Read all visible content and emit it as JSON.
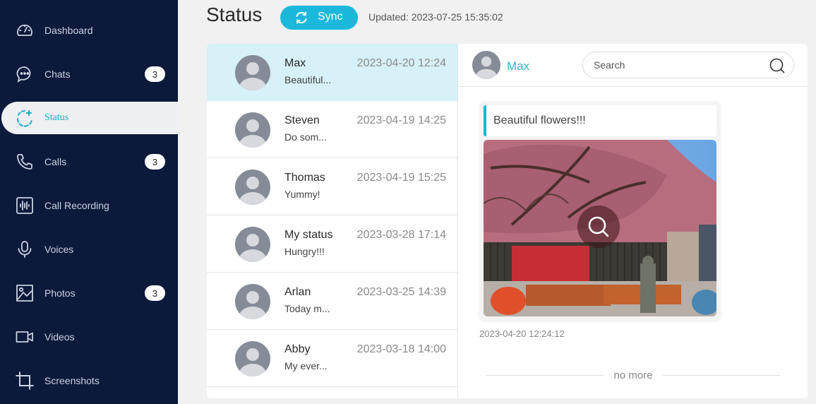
{
  "sidebar": {
    "items": [
      {
        "label": "Dashboard",
        "icon": "dashboard-icon",
        "badge": null,
        "active": false
      },
      {
        "label": "Chats",
        "icon": "chat-icon",
        "badge": "3",
        "active": false
      },
      {
        "label": "Status",
        "icon": "status-add-icon",
        "badge": null,
        "active": true
      },
      {
        "label": "Calls",
        "icon": "phone-icon",
        "badge": "3",
        "active": false
      },
      {
        "label": "Call Recording",
        "icon": "waveform-icon",
        "badge": null,
        "active": false
      },
      {
        "label": "Voices",
        "icon": "microphone-icon",
        "badge": null,
        "active": false
      },
      {
        "label": "Photos",
        "icon": "image-icon",
        "badge": "3",
        "active": false
      },
      {
        "label": "Videos",
        "icon": "video-camera-icon",
        "badge": null,
        "active": false
      },
      {
        "label": "Screenshots",
        "icon": "crop-icon",
        "badge": null,
        "active": false
      }
    ]
  },
  "header": {
    "title": "Status",
    "sync_label": "Sync",
    "updated": "Updated: 2023-07-25 15:35:02"
  },
  "statuses": [
    {
      "name": "Max",
      "preview": "Beautiful...",
      "time": "2023-04-20 12:24",
      "selected": true
    },
    {
      "name": "Steven",
      "preview": "Do som...",
      "time": "2023-04-19 14:25",
      "selected": false
    },
    {
      "name": "Thomas",
      "preview": "Yummy!",
      "time": "2023-04-19 15:25",
      "selected": false
    },
    {
      "name": "My status",
      "preview": "Hungry!!!",
      "time": "2023-03-28 17:14",
      "selected": false
    },
    {
      "name": "Arlan",
      "preview": "Today m...",
      "time": "2023-03-25 14:39",
      "selected": false
    },
    {
      "name": "Abby",
      "preview": "My ever...",
      "time": "2023-03-18 14:00",
      "selected": false
    }
  ],
  "detail": {
    "contact_name": "Max",
    "search_placeholder": "Search",
    "post": {
      "caption": "Beautiful flowers!!!",
      "timestamp": "2023-04-20 12:24:12"
    },
    "end_label": "no more"
  },
  "colors": {
    "sidebar_bg": "#0b1a3a",
    "accent": "#1bb8dc",
    "selected_row": "#d6f1f7"
  }
}
